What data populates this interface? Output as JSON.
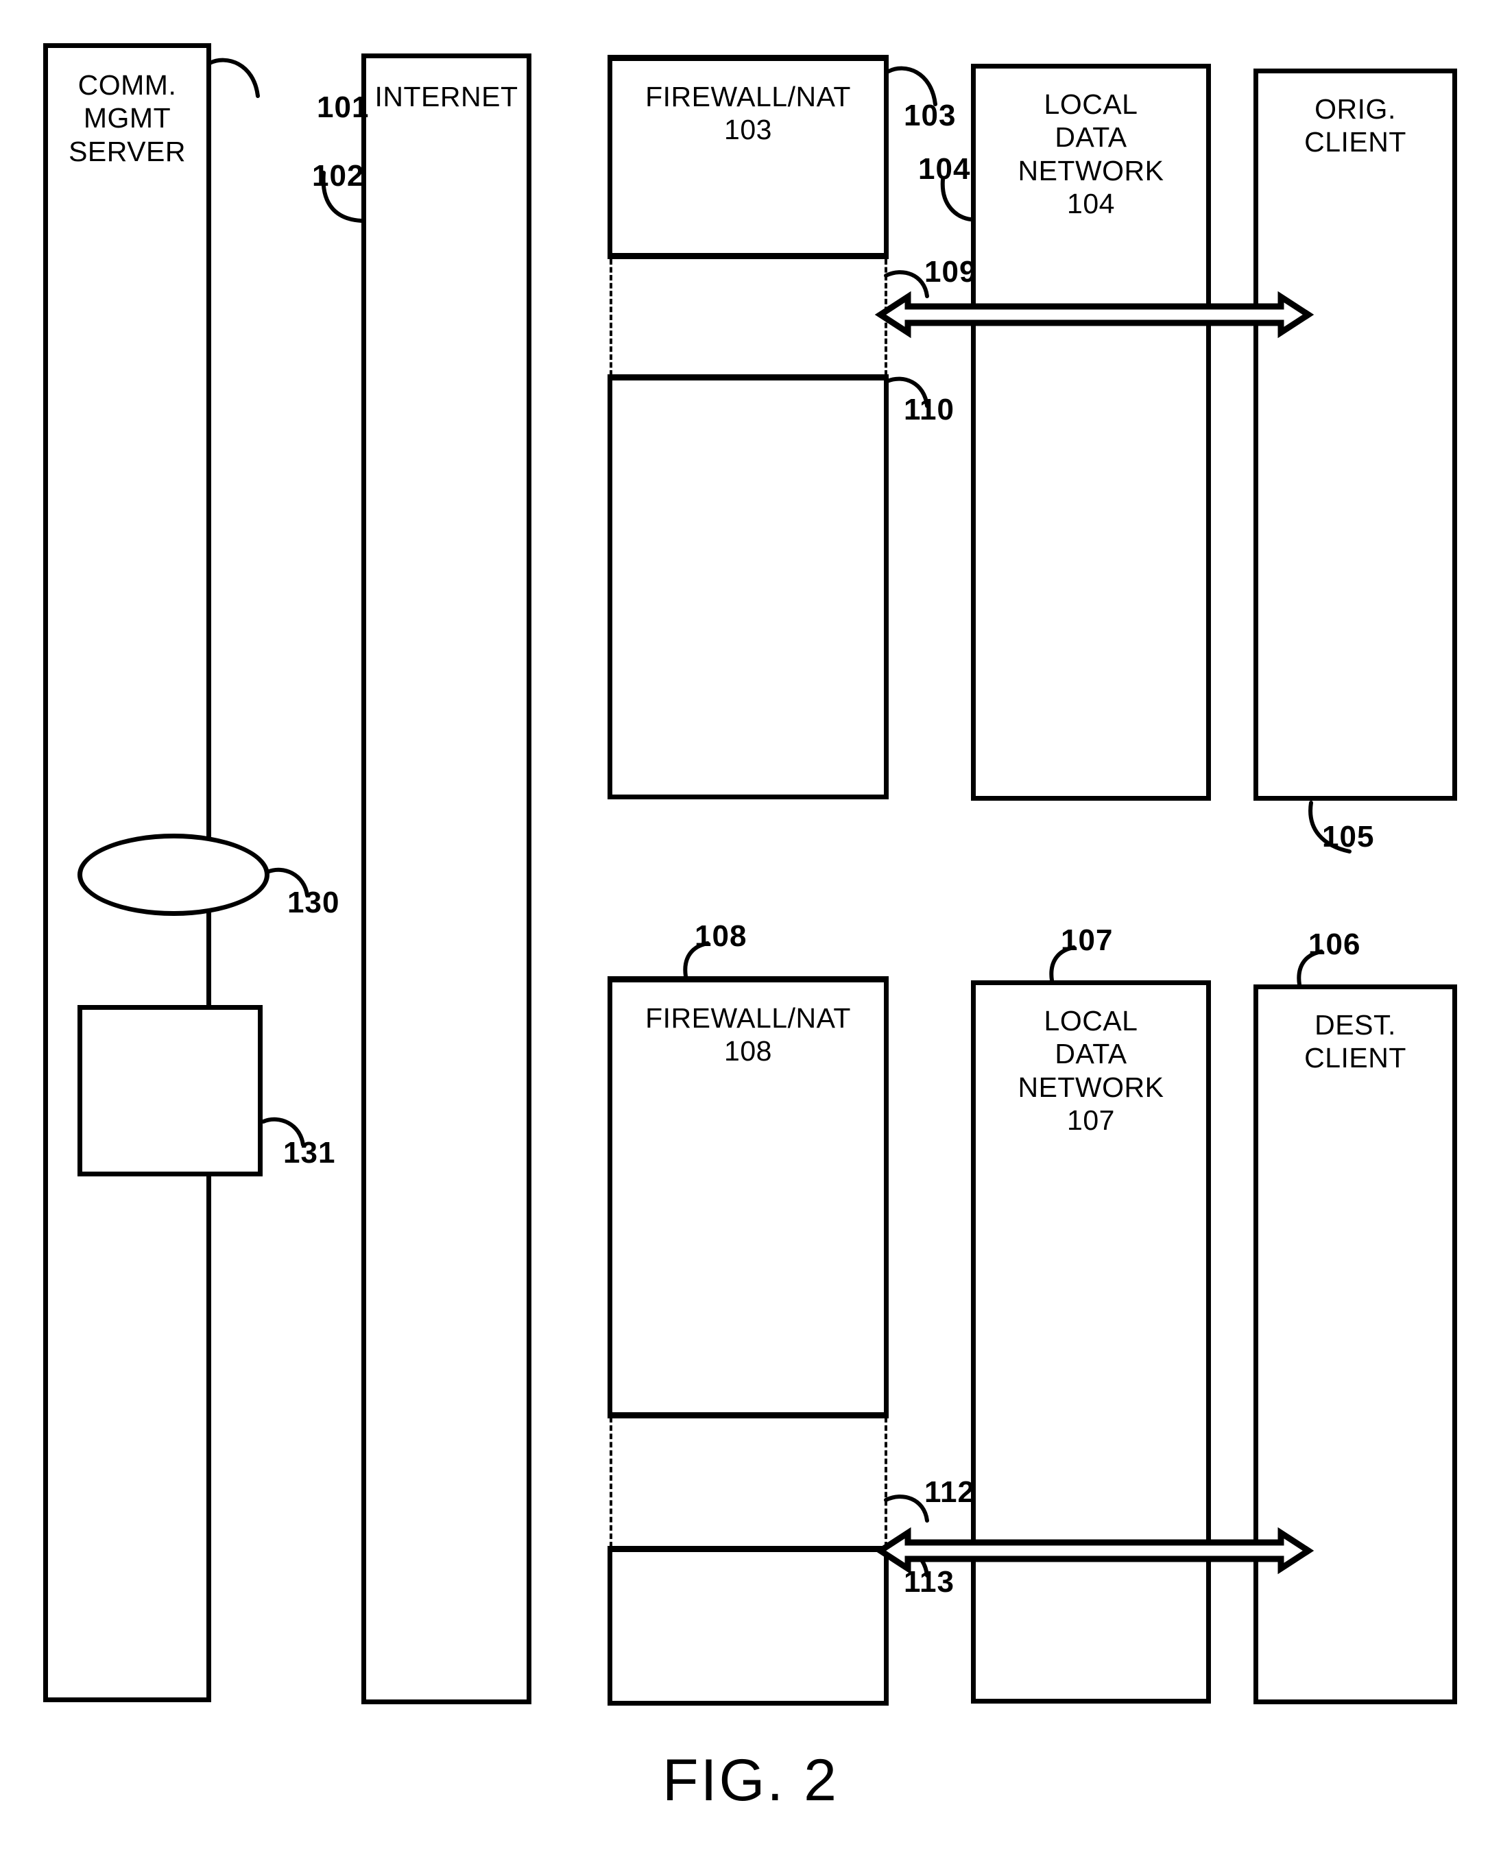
{
  "figure": {
    "caption": "FIG. 2",
    "background_color": "#ffffff",
    "line_color": "#000000"
  },
  "lanes": [
    {
      "id": "comm-mgmt-server",
      "label": "COMM. MGMT\nSERVER",
      "numeral": "101"
    },
    {
      "id": "internet",
      "label": "INTERNET",
      "numeral": "102"
    },
    {
      "id": "firewall-nat-103",
      "label": "FIREWALL/NAT\n103",
      "numeral": "103"
    },
    {
      "id": "local-data-network-104",
      "label": "LOCAL\nDATA\nNETWORK\n104",
      "numeral": "104"
    },
    {
      "id": "orig-client",
      "label": "ORIG.\nCLIENT",
      "numeral": "105"
    },
    {
      "id": "firewall-nat-108",
      "label": "FIREWALL/NAT\n108",
      "numeral": "108"
    },
    {
      "id": "local-data-network-107",
      "label": "LOCAL\nDATA\nNETWORK\n107",
      "numeral": "107"
    },
    {
      "id": "dest-client",
      "label": "DEST.\nCLIENT",
      "numeral": "106"
    }
  ],
  "inner_shapes": [
    {
      "id": "oval-130",
      "shape": "ellipse",
      "numeral": "130"
    },
    {
      "id": "square-131",
      "shape": "rectangle",
      "numeral": "131"
    }
  ],
  "arrows": [
    {
      "id": "arrow-109",
      "numeral": "109",
      "style": "double-headed-open",
      "from": "firewall-nat-103",
      "to": "orig-client"
    },
    {
      "id": "arrow-112",
      "numeral": "112",
      "style": "double-headed-open",
      "from": "firewall-nat-108",
      "to": "dest-client"
    }
  ],
  "gap_numerals": [
    {
      "id": "gap-110",
      "numeral": "110"
    },
    {
      "id": "gap-113",
      "numeral": "113"
    }
  ],
  "numerals": {
    "n101": "101",
    "n102": "102",
    "n103_lane": "103",
    "n103_lead": "103",
    "n104_lane": "104",
    "n104_lead": "104",
    "n105": "105",
    "n106": "106",
    "n107_lane": "107",
    "n107_lead": "107",
    "n108_lane": "108",
    "n108_lead": "108",
    "n109": "109",
    "n110": "110",
    "n112": "112",
    "n113": "113",
    "n130": "130",
    "n131": "131"
  }
}
